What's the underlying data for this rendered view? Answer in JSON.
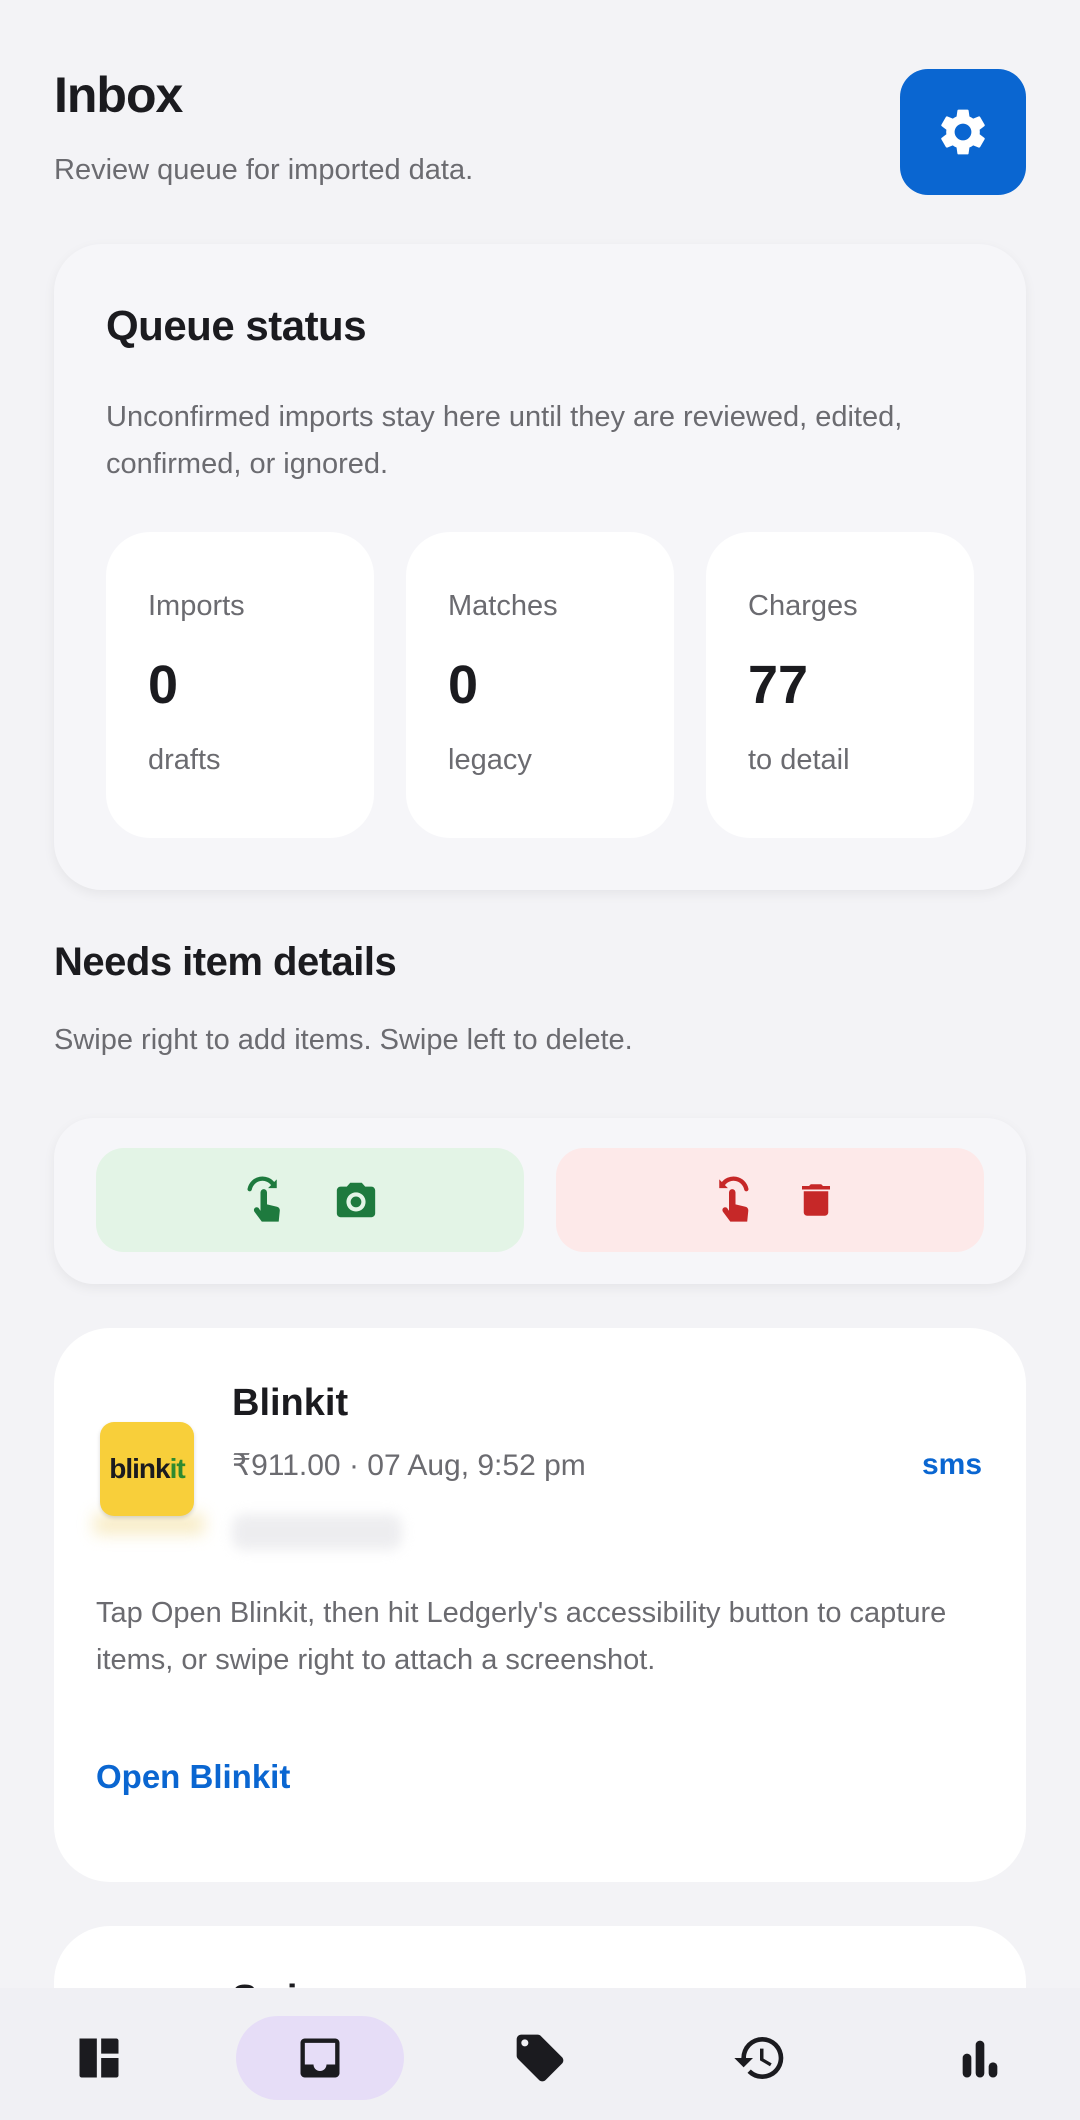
{
  "header": {
    "title": "Inbox",
    "subtitle": "Review queue for imported data.",
    "settings_icon": "gear-icon"
  },
  "queue": {
    "title": "Queue status",
    "description": "Unconfirmed imports stay here until they are reviewed, edited, confirmed, or ignored.",
    "stats": [
      {
        "label": "Imports",
        "value": "0",
        "sub": "drafts"
      },
      {
        "label": "Matches",
        "value": "0",
        "sub": "legacy"
      },
      {
        "label": "Charges",
        "value": "77",
        "sub": "to detail"
      }
    ]
  },
  "needs": {
    "title": "Needs item details",
    "subtitle": "Swipe right to add items. Swipe left to delete.",
    "swipe_right_icons": [
      "swipe-right-gesture-icon",
      "camera-icon"
    ],
    "swipe_left_icons": [
      "swipe-left-gesture-icon",
      "trash-icon"
    ]
  },
  "item": {
    "logo_text_a": "blink",
    "logo_text_b": "it",
    "name": "Blinkit",
    "meta": "₹911.00 · 07 Aug, 9:52 pm",
    "source": "sms",
    "description": "Tap Open Blinkit, then hit Ledgerly's accessibility button to capture items, or swipe right to attach a screenshot.",
    "action": "Open Blinkit"
  },
  "next_item": {
    "name_peek": "Swiggy"
  },
  "nav": {
    "items": [
      {
        "icon": "dashboard-icon",
        "active": false
      },
      {
        "icon": "inbox-icon",
        "active": true
      },
      {
        "icon": "tag-icon",
        "active": false
      },
      {
        "icon": "history-icon",
        "active": false
      },
      {
        "icon": "bar-chart-icon",
        "active": false
      }
    ]
  },
  "colors": {
    "accent": "#0a66d1",
    "background": "#f3f3f6",
    "swipe_right_bg": "#e3f4e6",
    "swipe_right_fg": "#1e7a3e",
    "swipe_left_bg": "#fde9e9",
    "swipe_left_fg": "#c62828",
    "nav_active_bg": "#e6ddf7",
    "logo_bg": "#f8cf3a"
  }
}
